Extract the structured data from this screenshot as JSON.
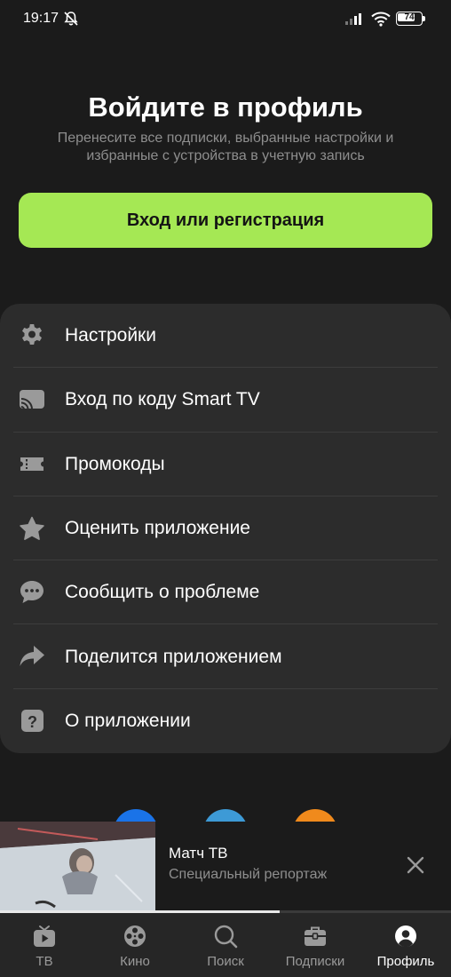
{
  "status_bar": {
    "time": "19:17",
    "battery": "74",
    "battery_level": 0.74
  },
  "header": {
    "title": "Войдите в профиль",
    "subtitle": "Перенесите все подписки, выбранные настройки и избранные с устройства в учетную запись",
    "login_button": "Вход или регистрация"
  },
  "menu": {
    "items": [
      {
        "label": "Настройки",
        "icon": "gear-icon"
      },
      {
        "label": "Вход по коду Smart TV",
        "icon": "cast-tv-icon"
      },
      {
        "label": "Промокоды",
        "icon": "ticket-icon"
      },
      {
        "label": "Оценить приложение",
        "icon": "star-icon"
      },
      {
        "label": "Сообщить о проблеме",
        "icon": "chat-bubble-icon"
      },
      {
        "label": "Поделится приложением",
        "icon": "share-arrow-icon"
      },
      {
        "label": "О приложении",
        "icon": "question-icon"
      }
    ]
  },
  "player": {
    "channel": "Матч ТВ",
    "program": "Специальный репортаж",
    "progress": 0.62
  },
  "nav": {
    "items": [
      {
        "label": "ТВ",
        "icon": "tv-play-icon",
        "active": false
      },
      {
        "label": "Кино",
        "icon": "film-reel-icon",
        "active": false
      },
      {
        "label": "Поиск",
        "icon": "search-icon",
        "active": false
      },
      {
        "label": "Подписки",
        "icon": "briefcase-icon",
        "active": false
      },
      {
        "label": "Профиль",
        "icon": "profile-icon",
        "active": true
      }
    ]
  },
  "colors": {
    "background": "#1b1b1b",
    "card": "#2c2c2c",
    "accent": "#a5e854",
    "muted_text": "#8e8e8e",
    "icon": "#9a9a9a"
  }
}
